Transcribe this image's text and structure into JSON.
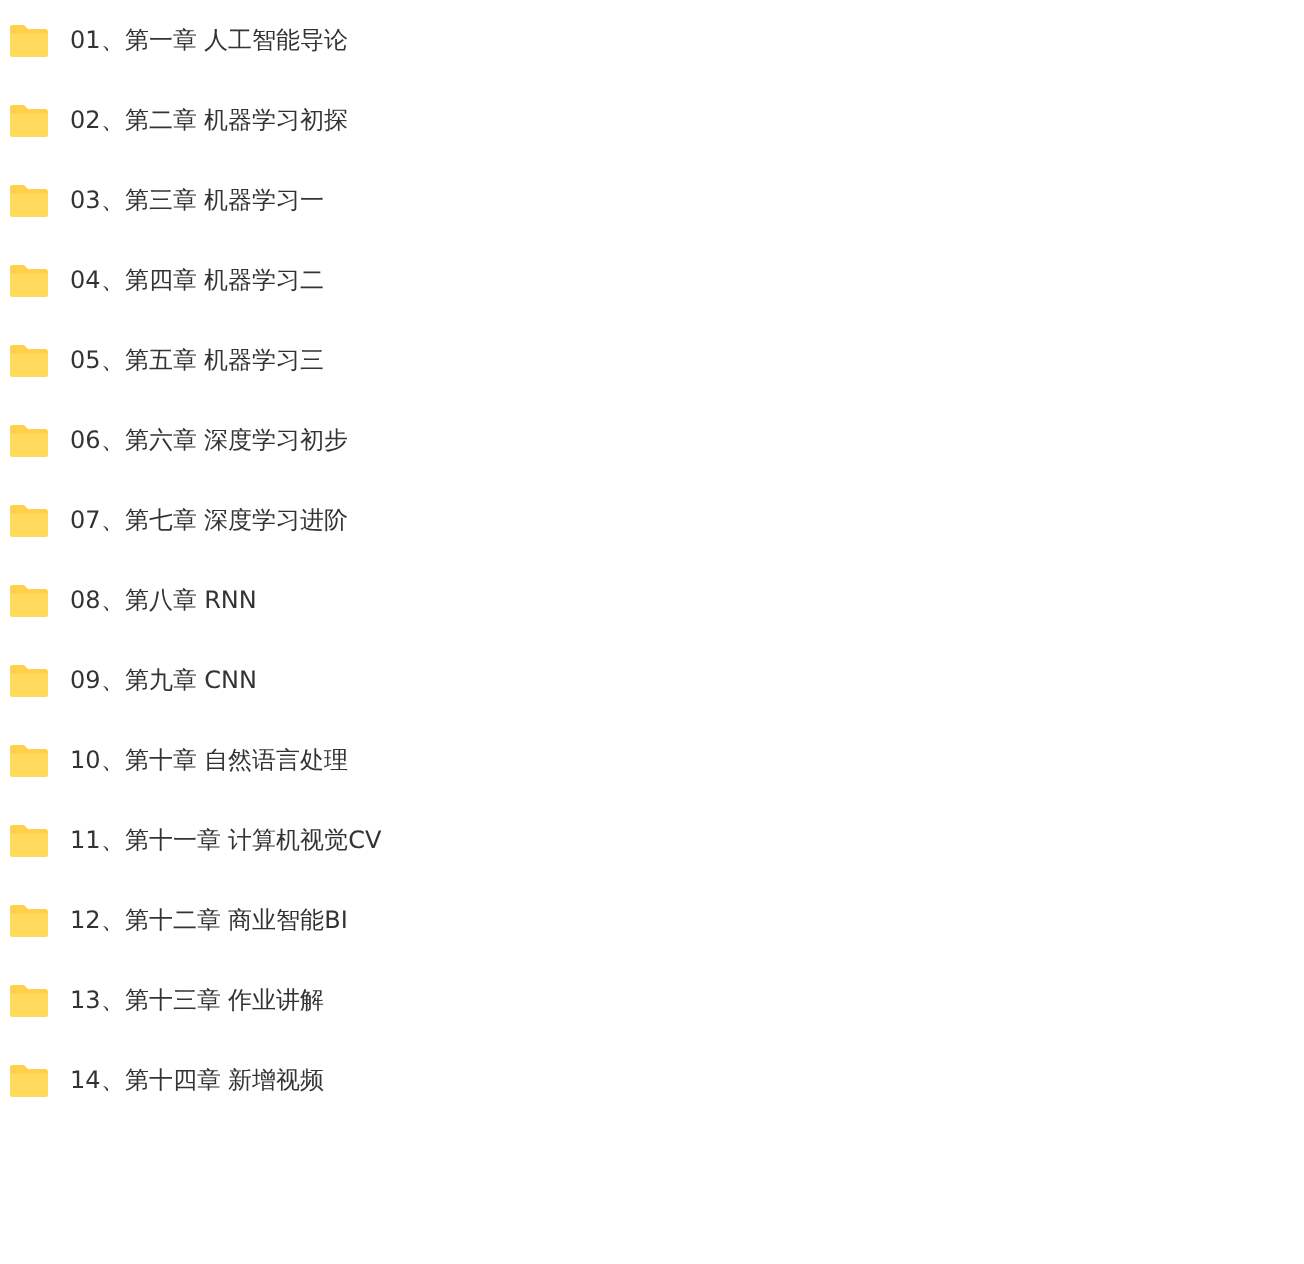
{
  "folders": [
    {
      "name": "01、第一章 人工智能导论"
    },
    {
      "name": "02、第二章 机器学习初探"
    },
    {
      "name": "03、第三章 机器学习一"
    },
    {
      "name": "04、第四章 机器学习二"
    },
    {
      "name": "05、第五章 机器学习三"
    },
    {
      "name": "06、第六章 深度学习初步"
    },
    {
      "name": "07、第七章 深度学习进阶"
    },
    {
      "name": "08、第八章 RNN"
    },
    {
      "name": "09、第九章 CNN"
    },
    {
      "name": "10、第十章 自然语言处理"
    },
    {
      "name": "11、第十一章 计算机视觉CV"
    },
    {
      "name": "12、第十二章 商业智能BI"
    },
    {
      "name": "13、第十三章 作业讲解"
    },
    {
      "name": "14、第十四章 新增视频"
    }
  ]
}
